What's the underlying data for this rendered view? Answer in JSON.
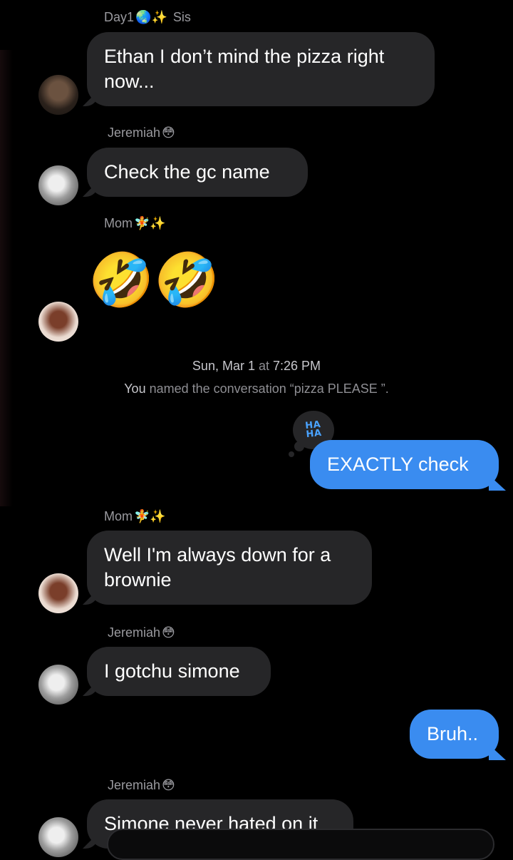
{
  "messages": [
    {
      "sender": "Day1",
      "sender_emoji": "🌏✨",
      "sender_suffix": "Sis",
      "text": "Ethan I don’t mind the pizza right now..."
    },
    {
      "sender": "Jeremiah",
      "sender_emoji": "😳",
      "text": "Check the gc name"
    },
    {
      "sender": "Mom",
      "sender_emoji": "🧚✨",
      "text": "🤣🤣"
    },
    {
      "timestamp_day": "Sun, Mar 1",
      "timestamp_at": "at",
      "timestamp_time": "7:26 PM"
    },
    {
      "system_actor": "You",
      "system_text": "named the conversation “pizza PLEASE ”."
    },
    {
      "tapback": "HA HA",
      "text": "EXACTLY check",
      "outgoing": true
    },
    {
      "sender": "Mom",
      "sender_emoji": "🧚✨",
      "text": "Well I'm always down for a brownie"
    },
    {
      "sender": "Jeremiah",
      "sender_emoji": "😳",
      "text": "I gotchu simone"
    },
    {
      "text": "Bruh..",
      "outgoing": true
    },
    {
      "sender": "Jeremiah",
      "sender_emoji": "😳",
      "text": "Simone never hated on it"
    }
  ],
  "colors": {
    "background": "#000000",
    "incoming_bubble": "#262628",
    "outgoing_bubble": "#3a8cf0",
    "secondary_text": "#8e8e93"
  }
}
